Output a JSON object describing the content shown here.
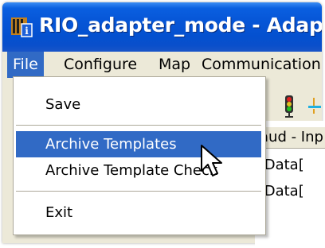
{
  "window": {
    "title": "RIO_adapter_mode - Adapte"
  },
  "menubar": {
    "items": [
      "File",
      "Configure",
      "Map",
      "Communication"
    ]
  },
  "file_menu": {
    "items": [
      "Save",
      "Archive Templates",
      "Archive Template Check",
      "Exit"
    ],
    "selected": "Archive Templates"
  },
  "content": {
    "column_header": "aud - Inp",
    "rows": [
      ".Data[",
      ".Data["
    ]
  },
  "icons": {
    "app": "app-icon",
    "toolbar": [
      "traffic-light-icon",
      "signal-icon"
    ],
    "cursor": "mouse-pointer-icon"
  },
  "colors": {
    "titlebar": "#0655d6",
    "highlight": "#316ac5",
    "menu_bg": "#ece9d8"
  }
}
